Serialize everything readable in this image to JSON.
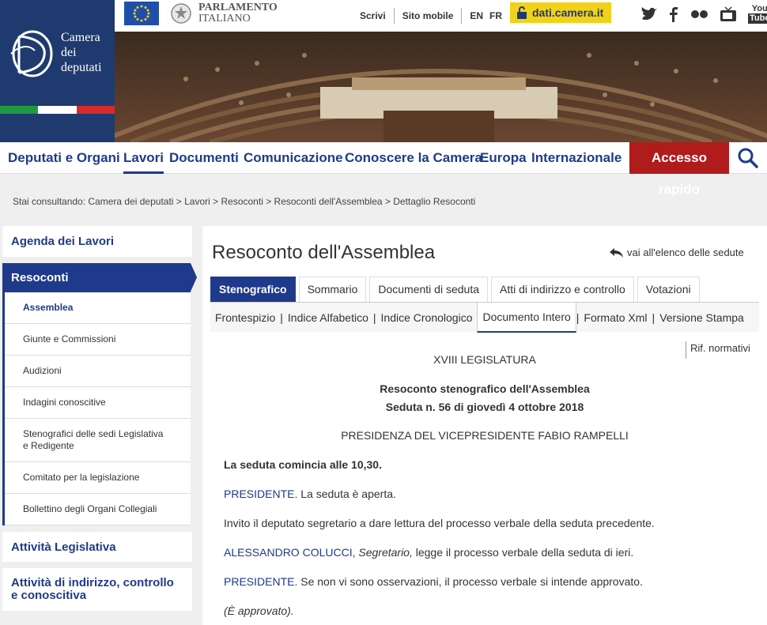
{
  "header": {
    "logo_text_1": "Camera",
    "logo_text_2": "dei",
    "logo_text_3": "deputati",
    "parliament_1": "PARLAMENTO",
    "parliament_2": "ITALIANO",
    "links": [
      "Scrivi",
      "Sito mobile"
    ],
    "lang_en": "EN",
    "lang_fr": "FR",
    "dati_label": "dati.camera.it",
    "youtube_1": "You",
    "youtube_2": "Tube"
  },
  "nav": {
    "items": [
      "Deputati e Organi",
      "Lavori",
      "Documenti",
      "Comunicazione",
      "Conoscere la Camera",
      "Europa",
      "Internazionale"
    ],
    "active": "Lavori",
    "rapido": "Accesso rapido"
  },
  "breadcrumb": "Stai consultando: Camera dei deputati > Lavori > Resoconti > Resoconti dell'Assemblea > Dettaglio Resoconti",
  "sidebar": {
    "agenda": "Agenda dei Lavori",
    "resoconti": "Resoconti",
    "sub_items": [
      "Assemblea",
      "Giunte e Commissioni",
      "Audizioni",
      "Indagini conoscitive",
      "Stenografici delle sedi Legislativa e Redigente",
      "Comitato per la legislazione",
      "Bollettino degli Organi Collegiali"
    ],
    "attivita_legislativa": "Attività Legislativa",
    "attivita_indirizzo": "Attività di indirizzo, controllo e conoscitiva"
  },
  "main": {
    "title": "Resoconto dell'Assemblea",
    "back_link": "vai all'elenco delle sedute",
    "tabs": [
      "Stenografico",
      "Sommario",
      "Documenti di seduta",
      "Atti di indirizzo e controllo",
      "Votazioni"
    ],
    "subtabs": [
      "Frontespizio",
      "Indice Alfabetico",
      "Indice Cronologico",
      "Documento Intero",
      "Formato Xml",
      "Versione Stampa"
    ],
    "rif": "Rif. normativi",
    "legislatura": "XVIII LEGISLATURA",
    "heading_1": "Resoconto stenografico dell'Assemblea",
    "heading_2": "Seduta n. 56 di giovedì 4 ottobre 2018",
    "presidenza": "PRESIDENZA DEL VICEPRESIDENTE FABIO RAMPELLI",
    "inizio": "La seduta comincia alle 10,30.",
    "presidente": "PRESIDENTE.",
    "p1_text": " La seduta è aperta.",
    "p2_text": "Invito il deputato segretario a dare lettura del processo verbale della seduta precedente.",
    "speaker": "ALESSANDRO COLUCCI,",
    "speaker_role": "Segretario,",
    "p3_text": " legge il processo verbale della seduta di ieri.",
    "p4_text": " Se non vi sono osservazioni, il processo verbale si intende approvato.",
    "approvato": "(È approvato)."
  },
  "colors": {
    "brand_blue": "#1f3a8a",
    "logo_blue": "#1f3a6e",
    "rapido_red": "#b01c1c",
    "dati_yellow": "#f2d11a"
  }
}
